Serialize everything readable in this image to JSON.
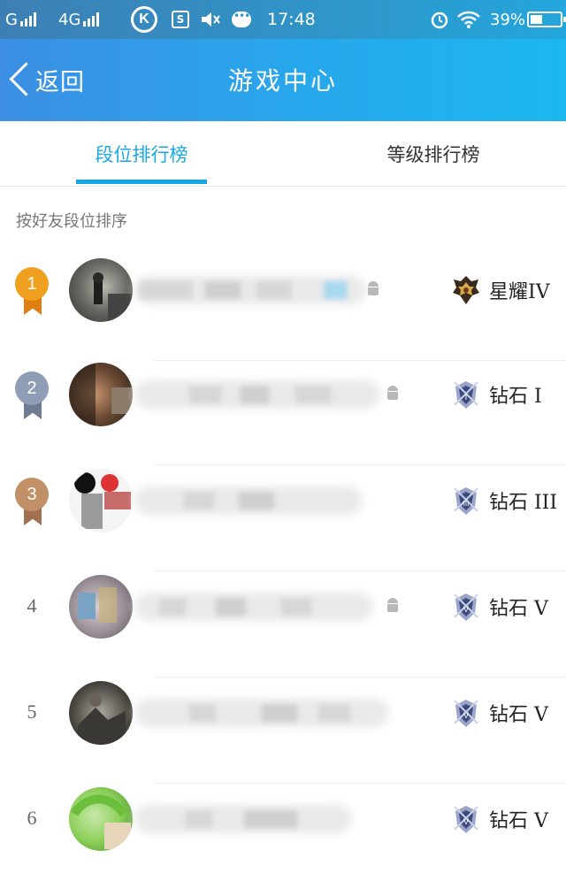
{
  "status_bar": {
    "carrier1": "G",
    "carrier2": "4G",
    "k_icon_text": "K",
    "s_icon_text": "S",
    "time": "17:48",
    "battery": "39%"
  },
  "header": {
    "back_label": "返回",
    "title": "游戏中心"
  },
  "tabs": [
    {
      "label": "段位排行榜",
      "active": true
    },
    {
      "label": "等级排行榜",
      "active": false
    }
  ],
  "sort_label": "按好友段位排序",
  "rows": [
    {
      "rank": "1",
      "tier": "星耀IV",
      "medal_color": "#f0a01f",
      "ribbon_color": "#e07f12"
    },
    {
      "rank": "2",
      "tier": "钻石 I",
      "medal_color": "#8f9db6",
      "ribbon_color": "#6d7b93"
    },
    {
      "rank": "3",
      "tier": "钻石 III",
      "medal_color": "#c19066",
      "ribbon_color": "#a27050"
    },
    {
      "rank": "4",
      "tier": "钻石 V"
    },
    {
      "rank": "5",
      "tier": "钻石 V"
    },
    {
      "rank": "6",
      "tier": "钻石 V"
    }
  ],
  "colors": {
    "accent": "#16a6e6",
    "header_gradient_start": "#3c8fe3",
    "header_gradient_end": "#1cb7ef"
  }
}
